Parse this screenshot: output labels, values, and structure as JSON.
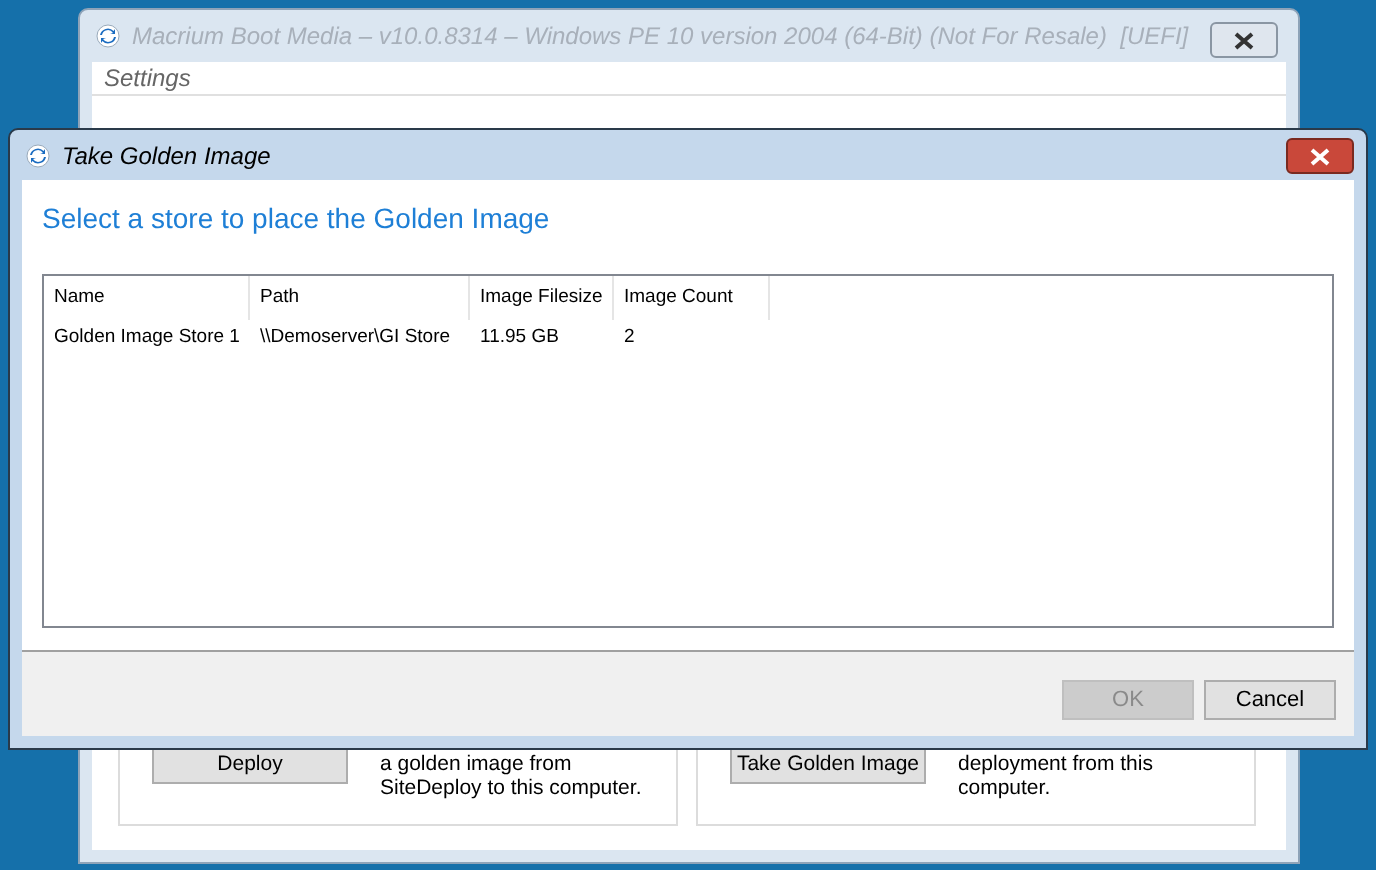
{
  "background_window": {
    "title": "Macrium Boot Media – v10.0.8314 – Windows PE 10 version 2004 (64-Bit) (Not For Resale)  [UEFI]",
    "menu": [
      "Settings"
    ],
    "panels": [
      {
        "button": "Deploy",
        "text_lines": [
          "a golden image from",
          "SiteDeploy to this computer."
        ]
      },
      {
        "button": "Take Golden Image",
        "text_lines": [
          "deployment from this",
          "computer."
        ]
      }
    ]
  },
  "dialog": {
    "title": "Take Golden Image",
    "heading": "Select a store to place the Golden Image",
    "table": {
      "columns": [
        "Name",
        "Path",
        "Image Filesize",
        "Image Count"
      ],
      "rows": [
        [
          "Golden Image Store 1",
          "\\\\Demoserver\\GI Store",
          "11.95 GB",
          "2"
        ]
      ]
    },
    "buttons": [
      {
        "label": "OK",
        "disabled": true
      },
      {
        "label": "Cancel",
        "disabled": false
      }
    ]
  }
}
